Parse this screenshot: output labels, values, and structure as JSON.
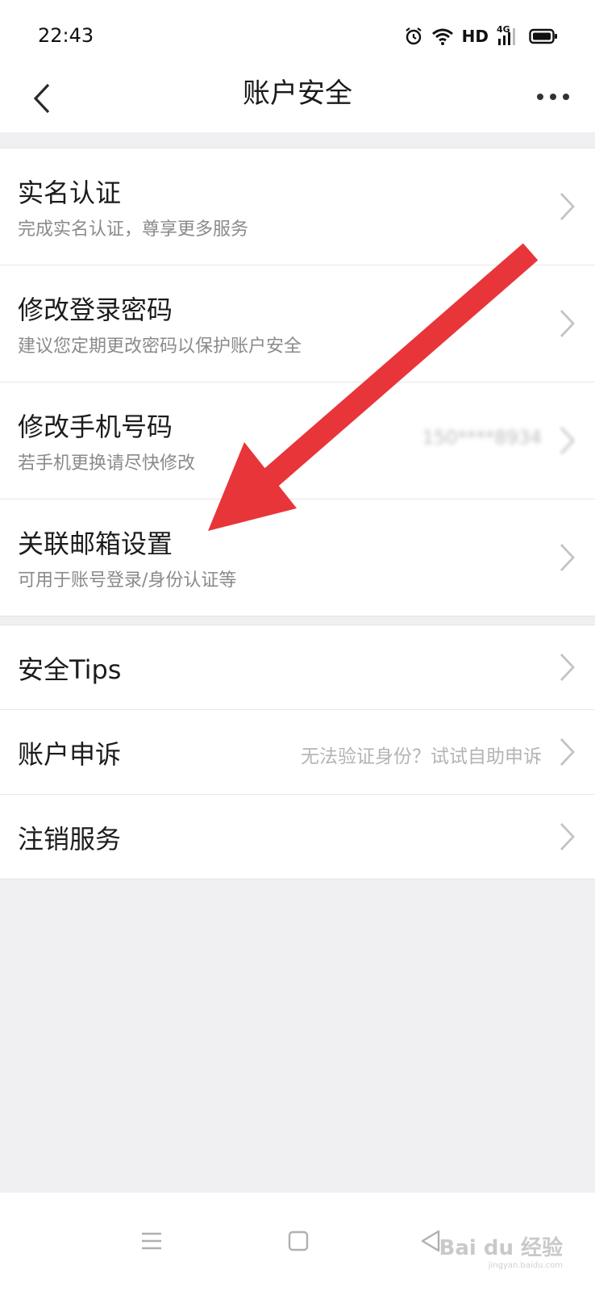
{
  "status_bar": {
    "time": "22:43",
    "hd_label": "HD",
    "network_label": "4G",
    "icons": [
      "alarm-icon",
      "wifi-icon",
      "signal-icon",
      "battery-icon"
    ]
  },
  "nav": {
    "title": "账户安全",
    "back_icon": "back-chevron-icon",
    "more_icon": "more-dots-icon"
  },
  "group1": {
    "items": [
      {
        "title": "实名认证",
        "subtitle": "完成实名认证，尊享更多服务"
      },
      {
        "title": "修改登录密码",
        "subtitle": "建议您定期更改密码以保护账户安全"
      },
      {
        "title": "修改手机号码",
        "subtitle": "若手机更换请尽快修改",
        "value": "150****8934"
      },
      {
        "title": "关联邮箱设置",
        "subtitle": "可用于账号登录/身份认证等"
      }
    ]
  },
  "group2": {
    "items": [
      {
        "title": "安全Tips"
      },
      {
        "title": "账户申诉",
        "value": "无法验证身份？试试自助申诉"
      },
      {
        "title": "注销服务"
      }
    ]
  },
  "bottom_nav": {
    "icons": [
      "menu-icon",
      "home-square-icon",
      "back-triangle-icon"
    ]
  },
  "watermark": {
    "brand": "Bai du 经验",
    "url": "jingyan.baidu.com"
  },
  "colors": {
    "background": "#f0f0f2",
    "card": "#ffffff",
    "annotation_arrow": "#e8353a"
  }
}
